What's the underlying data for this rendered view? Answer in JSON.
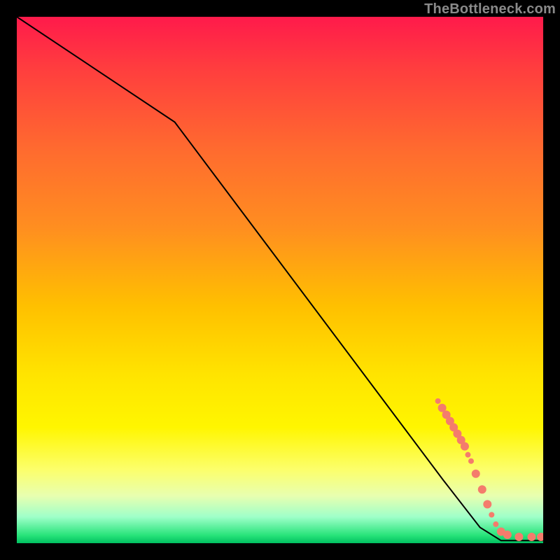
{
  "watermark": "TheBottleneck.com",
  "chart_data": {
    "type": "line",
    "title": "",
    "xlabel": "",
    "ylabel": "",
    "xlim": [
      0,
      100
    ],
    "ylim": [
      0,
      100
    ],
    "grid": false,
    "legend": false,
    "series": [
      {
        "name": "bottleneck-curve",
        "color": "#000000",
        "x": [
          0,
          30,
          81,
          88,
          92,
          100
        ],
        "y": [
          100,
          80,
          12,
          3,
          0.5,
          0.5
        ]
      }
    ],
    "markers": {
      "name": "data-points",
      "color": "#f47c6c",
      "radius_small": 4,
      "radius_large": 6,
      "points": [
        {
          "x": 80.0,
          "y": 27.0,
          "r": "small"
        },
        {
          "x": 80.8,
          "y": 25.7,
          "r": "large"
        },
        {
          "x": 81.6,
          "y": 24.4,
          "r": "large"
        },
        {
          "x": 82.3,
          "y": 23.2,
          "r": "large"
        },
        {
          "x": 83.0,
          "y": 22.0,
          "r": "large"
        },
        {
          "x": 83.7,
          "y": 20.8,
          "r": "large"
        },
        {
          "x": 84.4,
          "y": 19.6,
          "r": "large"
        },
        {
          "x": 85.1,
          "y": 18.4,
          "r": "large"
        },
        {
          "x": 85.7,
          "y": 16.8,
          "r": "small"
        },
        {
          "x": 86.3,
          "y": 15.6,
          "r": "small"
        },
        {
          "x": 87.2,
          "y": 13.2,
          "r": "large"
        },
        {
          "x": 88.4,
          "y": 10.2,
          "r": "large"
        },
        {
          "x": 89.4,
          "y": 7.4,
          "r": "large"
        },
        {
          "x": 90.2,
          "y": 5.4,
          "r": "small"
        },
        {
          "x": 91.0,
          "y": 3.6,
          "r": "small"
        },
        {
          "x": 92.0,
          "y": 2.2,
          "r": "large"
        },
        {
          "x": 93.2,
          "y": 1.6,
          "r": "large"
        },
        {
          "x": 95.4,
          "y": 1.2,
          "r": "large"
        },
        {
          "x": 97.8,
          "y": 1.2,
          "r": "large"
        },
        {
          "x": 99.6,
          "y": 1.2,
          "r": "large"
        }
      ]
    }
  }
}
